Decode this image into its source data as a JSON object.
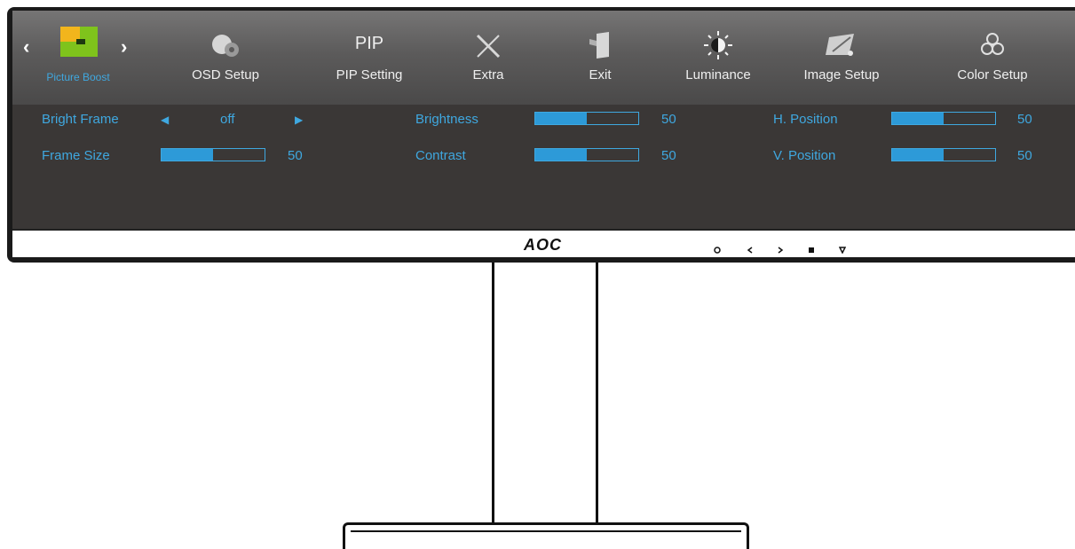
{
  "brand": {
    "logo_text": "AOC"
  },
  "tabs": [
    {
      "label": "Picture Boost",
      "icon": "picture-boost-icon",
      "active": true
    },
    {
      "label": "OSD Setup",
      "icon": "osd-setup-icon"
    },
    {
      "label": "PIP Setting",
      "icon_text": "PIP"
    },
    {
      "label": "Extra",
      "icon": "tools-icon"
    },
    {
      "label": "Exit",
      "icon": "exit-icon"
    },
    {
      "label": "Luminance",
      "icon": "luminance-icon"
    },
    {
      "label": "Image Setup",
      "icon": "image-setup-icon"
    },
    {
      "label": "Color Setup",
      "icon": "color-setup-icon"
    }
  ],
  "settings": {
    "bright_frame": {
      "label": "Bright Frame",
      "value": "off"
    },
    "frame_size": {
      "label": "Frame Size",
      "value": "50",
      "level": 0.5
    },
    "brightness": {
      "label": "Brightness",
      "value": "50",
      "level": 0.5
    },
    "contrast": {
      "label": "Contrast",
      "value": "50",
      "level": 0.5
    },
    "h_position": {
      "label": "H. Position",
      "value": "50",
      "level": 0.5
    },
    "v_position": {
      "label": "V. Position",
      "value": "50",
      "level": 0.5
    }
  },
  "colors": {
    "accent": "#3fa8e0",
    "osd_background": "#3a3736",
    "icon_yellow": "#f2b51c",
    "icon_green": "#7fc31c"
  }
}
